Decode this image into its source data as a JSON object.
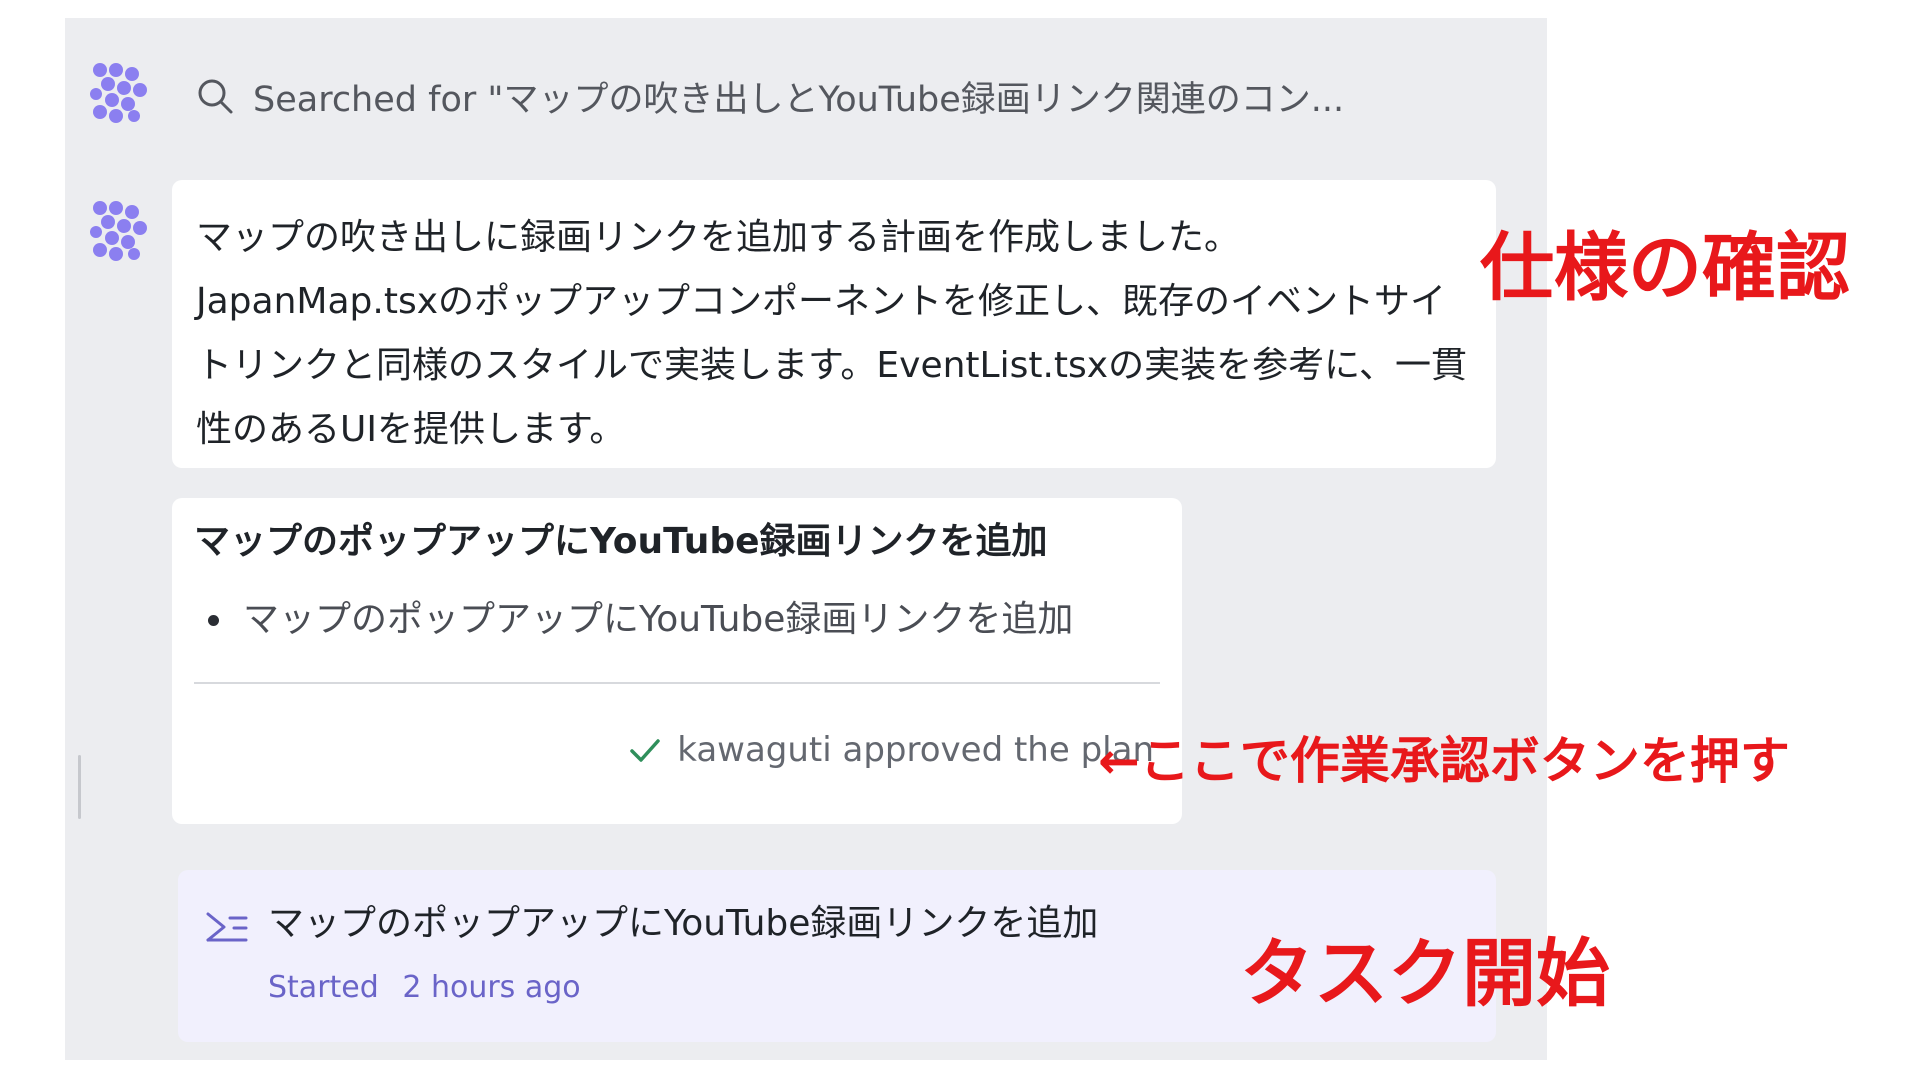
{
  "search": {
    "text": "Searched for \"マップの吹き出しとYouTube録画リンク関連のコン..."
  },
  "message": {
    "text": "マップの吹き出しに録画リンクを追加する計画を作成しました。JapanMap.tsxのポップアップコンポーネントを修正し、既存のイベントサイトリンクと同様のスタイルで実装します。EventList.tsxの実装を参考に、一貫性のあるUIを提供します。"
  },
  "plan": {
    "title": "マップのポップアップにYouTube録画リンクを追加",
    "items": [
      {
        "label": "マップのポップアップにYouTube録画リンクを追加"
      }
    ],
    "approval": "kawaguti approved the plan"
  },
  "task": {
    "title": "マップのポップアップにYouTube録画リンクを追加",
    "status_label": "Started",
    "time": "2 hours ago"
  },
  "annotations": {
    "spec": "仕様の確認",
    "approve": "←ここで作業承認ボタンを押す",
    "task_start": "タスク開始"
  },
  "icons": {
    "agent_avatar": "agent-logo-icon",
    "search": "search-icon",
    "check": "check-icon",
    "task": "task-list-icon"
  },
  "colors": {
    "avatar": "#8b7ff0",
    "check": "#2f8f5b",
    "task_status": "#6a64c8",
    "annotation": "#e8181b"
  }
}
